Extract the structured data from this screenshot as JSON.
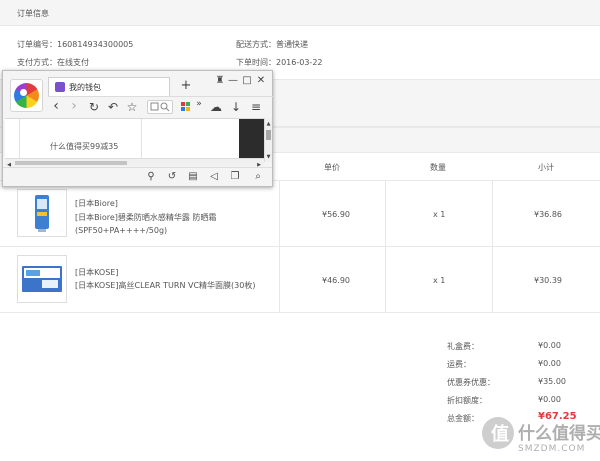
{
  "order": {
    "section_title": "订单信息",
    "number_label": "订单编号：",
    "number": "160814934300005",
    "delivery_label": "配送方式：",
    "delivery": "普通快递",
    "payment_label": "支付方式：",
    "payment": "在线支付",
    "date_label": "下单时间：",
    "date": "2016-03-22"
  },
  "table": {
    "headers": {
      "price": "单价",
      "qty": "数量",
      "subtotal": "小计"
    },
    "rows": [
      {
        "brand": "[日本Biore]",
        "name_line1": "[日本Biore]碧柔防晒水感精华露 防晒霜",
        "name_line2": "(SPF50+PA++++/50g)",
        "price": "¥56.90",
        "qty": "x 1",
        "subtotal": "¥36.86"
      },
      {
        "brand": "[日本KOSE]",
        "name_line1": "[日本KOSE]高丝CLEAR TURN VC精华面膜(30枚)",
        "price": "¥46.90",
        "qty": "x 1",
        "subtotal": "¥30.39"
      }
    ]
  },
  "totals": [
    {
      "label": "礼盒费：",
      "value": "¥0.00"
    },
    {
      "label": "运费：",
      "value": "¥0.00"
    },
    {
      "label": "优惠券优惠：",
      "value": "¥35.00"
    },
    {
      "label": "折扣额度：",
      "value": "¥0.00"
    },
    {
      "label": "总金额：",
      "value": "¥67.25"
    }
  ],
  "browser": {
    "tab_title": "我的钱包",
    "caption": "什么值得买99减35",
    "title_glyphs": {
      "shirt": "♜",
      "minimize": "—",
      "maximize": "□",
      "close": "✕"
    },
    "nav_glyphs": {
      "new_tab": "+",
      "back": "‹",
      "forward": "›",
      "reload": "↻",
      "undo": "↶",
      "star": "☆",
      "more": "»",
      "cloud": "☁",
      "download": "↓",
      "menu": "≡"
    },
    "status_glyphs": {
      "pin": "⚲",
      "share": "↺",
      "trash": "▤",
      "speaker": "◁",
      "window": "❐",
      "zoom": "⌕"
    },
    "scroll_glyphs": {
      "up": "▲",
      "down": "▼",
      "left": "◀",
      "right": "▶"
    }
  },
  "watermark": {
    "glyph": "值",
    "title": "什么值得买",
    "url": "SMZDM.COM"
  },
  "colors": {
    "accent_red": "#e4393c",
    "section_bg": "#f5f5f5",
    "tab_icon": "#7b4fd4"
  }
}
